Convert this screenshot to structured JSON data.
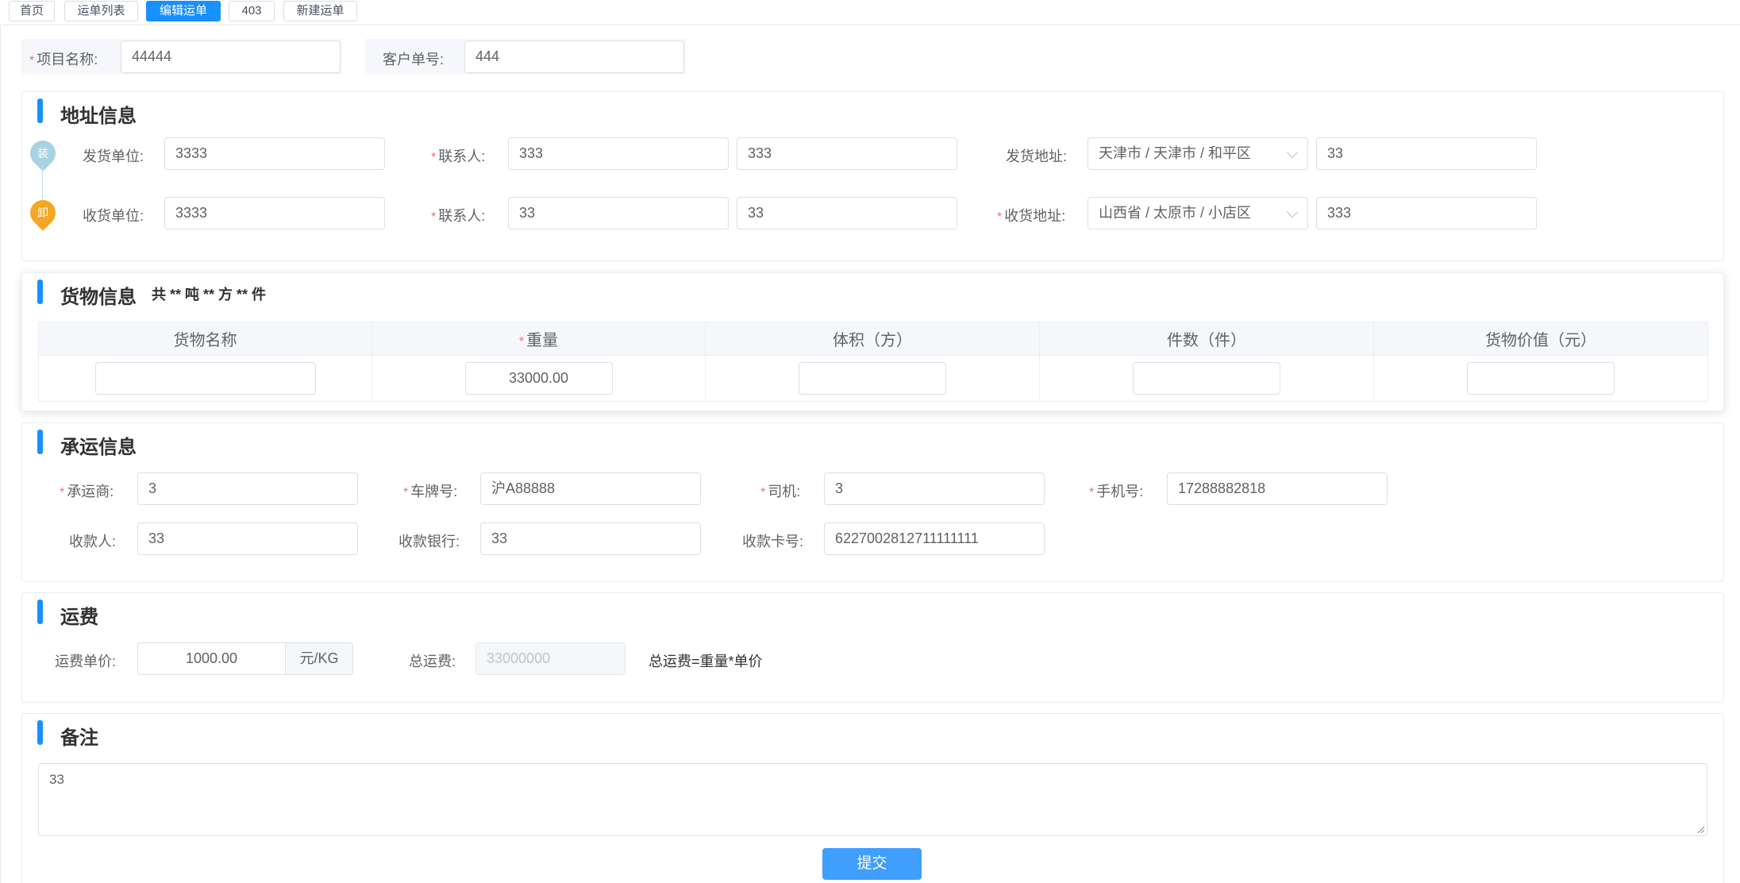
{
  "tags": [
    "首页",
    "运单列表",
    "编辑运单",
    "403",
    "新建运单"
  ],
  "header": {
    "project_label": "项目名称:",
    "project_value": "44444",
    "customer_label": "客户单号:",
    "customer_value": "444"
  },
  "address": {
    "title": "地址信息",
    "pickup": {
      "marker": "装",
      "unit_label": "发货单位:",
      "unit_value": "3333",
      "contact_label": "联系人:",
      "contact_value": "333",
      "phone_value": "333",
      "addr_label": "发货地址:",
      "region_value": "天津市 / 天津市 / 和平区",
      "detail_value": "33"
    },
    "delivery": {
      "marker": "卸",
      "unit_label": "收货单位:",
      "unit_value": "3333",
      "contact_label": "联系人:",
      "contact_value": "33",
      "phone_value": "33",
      "addr_label": "收货地址:",
      "region_value": "山西省 / 太原市 / 小店区",
      "detail_value": "333"
    }
  },
  "goods": {
    "title": "货物信息",
    "summary": "共 ** 吨 ** 方 ** 件",
    "columns": [
      "货物名称",
      "重量",
      "体积（方）",
      "件数（件）",
      "货物价值（元）"
    ],
    "row": [
      "",
      "33000.00",
      "",
      "",
      ""
    ]
  },
  "carrier": {
    "title": "承运信息",
    "carrier_label": "承运商:",
    "carrier_value": "3",
    "plate_label": "车牌号:",
    "plate_value": "沪A88888",
    "driver_label": "司机:",
    "driver_value": "3",
    "mobile_label": "手机号:",
    "mobile_value": "17288882818",
    "payee_label": "收款人:",
    "payee_value": "33",
    "bank_label": "收款银行:",
    "bank_value": "33",
    "card_label": "收款卡号:",
    "card_value": "6227002812711111111"
  },
  "freight": {
    "title": "运费",
    "unit_price_label": "运费单价:",
    "unit_price_value": "1000.00",
    "unit_suffix": "元/KG",
    "total_label": "总运费:",
    "total_value": "33000000",
    "formula": "总运费=重量*单价"
  },
  "remark": {
    "title": "备注",
    "value": "33"
  },
  "submit_label": "提交",
  "colors": {
    "primary": "#1890ff",
    "button": "#409eff",
    "required": "#f56c6c",
    "pickup_marker": "#a7d2e2",
    "delivery_marker": "#f5a623"
  }
}
